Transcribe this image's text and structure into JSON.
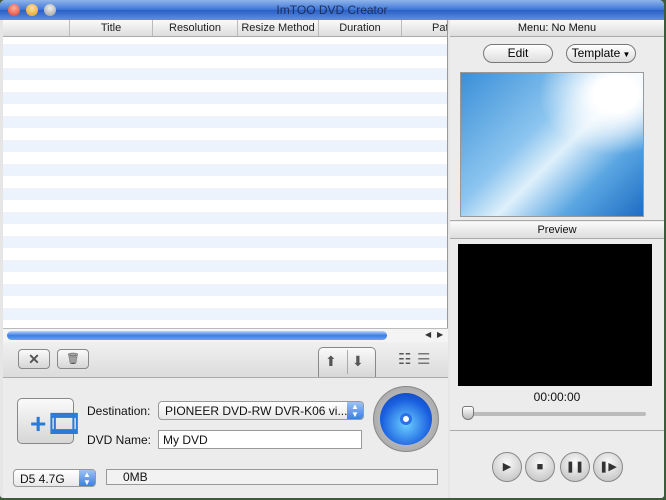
{
  "window": {
    "title": "ImTOO DVD Creator"
  },
  "table": {
    "columns": [
      "",
      "Title",
      "Resolution",
      "Resize Method",
      "Duration",
      "Path"
    ]
  },
  "toolbar": {
    "remove_icon": "x-icon",
    "delete_icon": "trash-icon",
    "up_icon": "arrow-up-icon",
    "down_icon": "arrow-down-icon"
  },
  "output": {
    "destination_label": "Destination:",
    "destination_value": "PIONEER DVD-RW  DVR-K06 vi...",
    "dvd_name_label": "DVD Name:",
    "dvd_name_value": "My DVD",
    "disc_type": "D5 4.7G",
    "size_used": "0MB"
  },
  "menu": {
    "header": "Menu:  No Menu",
    "edit_label": "Edit",
    "template_label": "Template"
  },
  "preview": {
    "header": "Preview",
    "time": "00:00:00",
    "position": 0
  }
}
